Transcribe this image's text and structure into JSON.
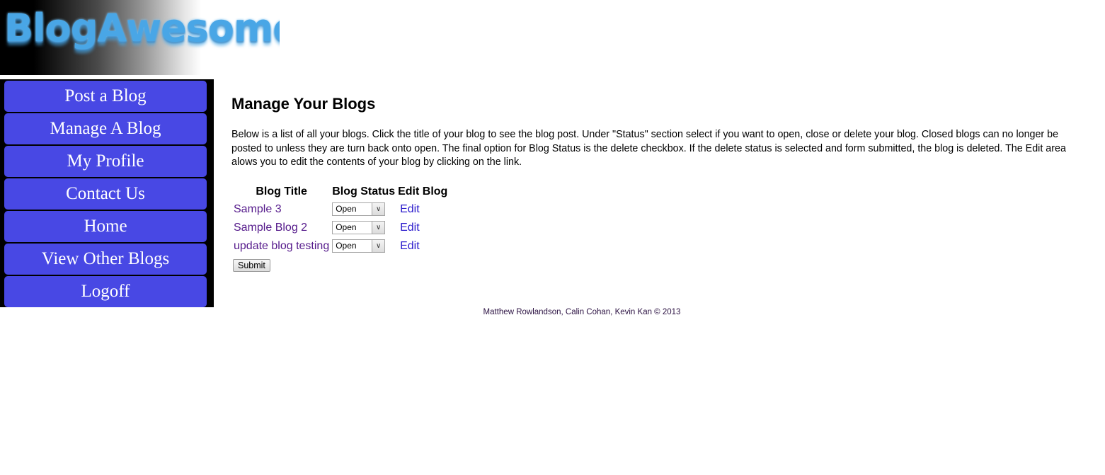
{
  "logo": {
    "text": "BlogAwesome!"
  },
  "sidebar": {
    "items": [
      {
        "label": "Post a Blog"
      },
      {
        "label": "Manage A Blog"
      },
      {
        "label": "My Profile"
      },
      {
        "label": "Contact Us"
      },
      {
        "label": "Home"
      },
      {
        "label": "View Other Blogs"
      },
      {
        "label": "Logoff"
      }
    ]
  },
  "main": {
    "title": "Manage Your Blogs",
    "intro": "Below is a list of all your blogs. Click the title of your blog to see the blog post. Under \"Status\" section select if you want to open, close or delete your blog. Closed blogs can no longer be posted to unless they are turn back onto open. The final option for Blog Status is the delete checkbox. If the delete status is selected and form submitted, the blog is deleted. The Edit area alows you to edit the contents of your blog by clicking on the link.",
    "table": {
      "headers": [
        "Blog Title",
        "Blog Status",
        "Edit Blog"
      ],
      "rows": [
        {
          "title": "Sample 3",
          "status": "Open",
          "edit": "Edit"
        },
        {
          "title": "Sample Blog 2",
          "status": "Open",
          "edit": "Edit"
        },
        {
          "title": "update blog testing",
          "status": "Open",
          "edit": "Edit"
        }
      ]
    },
    "submit_label": "Submit"
  },
  "footer": {
    "text": "Matthew Rowlandson, Calin Cohan, Kevin Kan © 2013"
  },
  "colors": {
    "nav_button": "#4848e4",
    "sidebar_bg": "#000000",
    "logo_text": "#49a6e6",
    "visited_link": "#551a8b"
  },
  "icons": {
    "select_arrow": "chevron-down-icon"
  }
}
